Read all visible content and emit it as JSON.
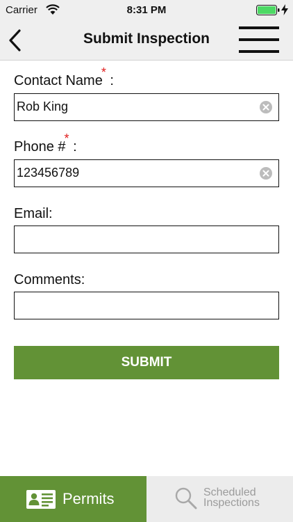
{
  "status_bar": {
    "carrier": "Carrier",
    "time": "8:31 PM"
  },
  "nav": {
    "title": "Submit Inspection"
  },
  "form": {
    "contact_name": {
      "label": "Contact Name",
      "required_mark": "*",
      "suffix": " :",
      "value": "Rob King"
    },
    "phone": {
      "label": "Phone #",
      "required_mark": "*",
      "suffix": " :",
      "value": "123456789"
    },
    "email": {
      "label": "Email:",
      "value": ""
    },
    "comments": {
      "label": "Comments:",
      "value": ""
    },
    "submit_label": "SUBMIT"
  },
  "tabs": {
    "permits_label": "Permits",
    "scheduled_line1": "Scheduled",
    "scheduled_line2": "Inspections"
  },
  "colors": {
    "accent_green": "#629236",
    "required_red": "#e01e1e",
    "bar_gray": "#efefef"
  },
  "icons": [
    "wifi-icon",
    "battery-icon",
    "charging-bolt-icon",
    "back-chevron-icon",
    "hamburger-menu-icon",
    "clear-icon",
    "id-card-icon",
    "magnifier-icon"
  ]
}
